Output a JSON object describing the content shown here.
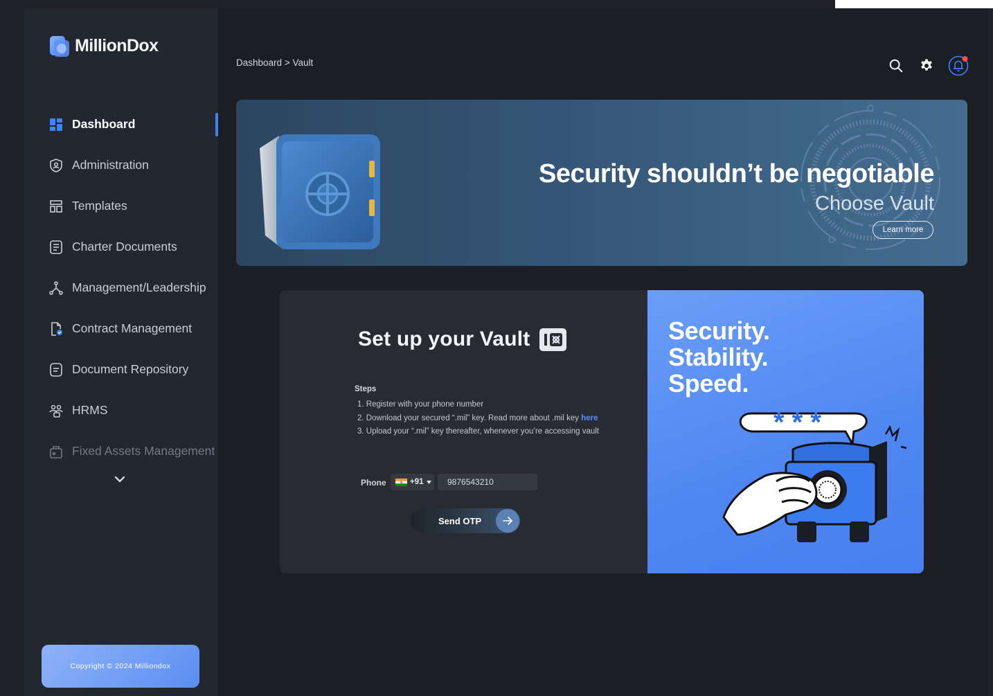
{
  "app": {
    "name": "MillionDox"
  },
  "sidebar": {
    "items": [
      {
        "label": "Dashboard",
        "icon": "dashboard-icon",
        "active": true
      },
      {
        "label": "Administration",
        "icon": "shield-user-icon"
      },
      {
        "label": "Templates",
        "icon": "template-icon"
      },
      {
        "label": "Charter Documents",
        "icon": "document-list-icon"
      },
      {
        "label": "Management/Leadership",
        "icon": "hierarchy-icon"
      },
      {
        "label": "Contract Management",
        "icon": "contract-check-icon"
      },
      {
        "label": "Document Repository",
        "icon": "repository-icon"
      },
      {
        "label": "HRMS",
        "icon": "people-icon"
      },
      {
        "label": "Fixed Assets Management",
        "icon": "asset-icon",
        "faded": true
      }
    ],
    "more_icon": "chevron-down-icon",
    "copyright": "Copyright © 2024 Milliondox"
  },
  "header": {
    "breadcrumb": {
      "root": "Dashboard",
      "separator": ">",
      "current": "Vault"
    },
    "icons": [
      "search-icon",
      "gear-icon",
      "bell-icon"
    ]
  },
  "banner": {
    "title": "Security shouldn’t be negotiable",
    "subtitle": "Choose Vault",
    "cta": "Learn more"
  },
  "vault_setup": {
    "title": "Set up your Vault",
    "steps_heading": "Steps",
    "steps": [
      {
        "text": "1. Register with your phone number"
      },
      {
        "text": "2. Download your secured “.mil” key. Read more about .mil key ",
        "link": "here"
      },
      {
        "text": "3. Upload your “.mil” key thereafter, whenever you’re accessing vault"
      }
    ],
    "phone_label": "Phone",
    "country_code": "+91",
    "phone_value": "9876543210",
    "send_button": "Send OTP"
  },
  "promo": {
    "lines": [
      "Security.",
      "Stability.",
      "Speed."
    ]
  },
  "colors": {
    "accent": "#3f83f8",
    "promo_blue": "#4f86f1",
    "link": "#5b8ff8",
    "notification_dot": "#ff4b4b"
  }
}
